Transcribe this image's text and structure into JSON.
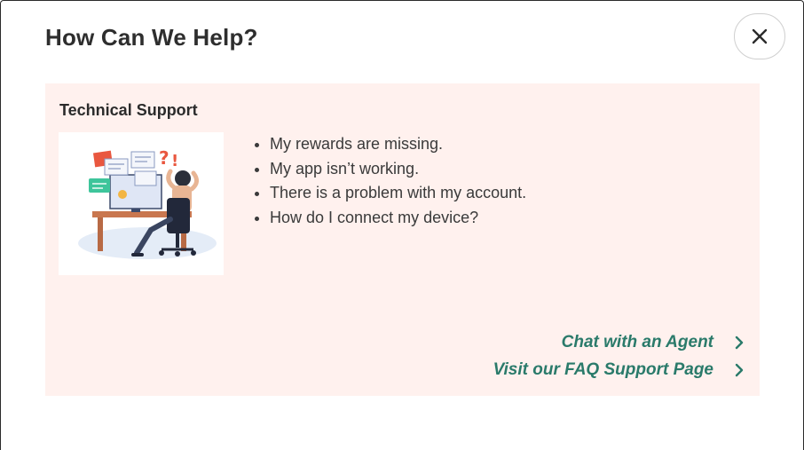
{
  "modal": {
    "title": "How Can We Help?"
  },
  "support_card": {
    "title": "Technical Support",
    "issues": [
      "My rewards are missing.",
      "My app isn’t working.",
      "There is a problem with my account.",
      "How do I connect my device?"
    ],
    "links": {
      "chat_label": "Chat with an Agent",
      "faq_label": "Visit our FAQ Support Page"
    }
  },
  "icons": {
    "close": "close-icon",
    "chevron": "chevron-right-icon",
    "illustration": "stressed-worker-illustration"
  },
  "colors": {
    "card_background": "#fff1ee",
    "link": "#2a7a6a",
    "title": "#2e2e2e"
  }
}
